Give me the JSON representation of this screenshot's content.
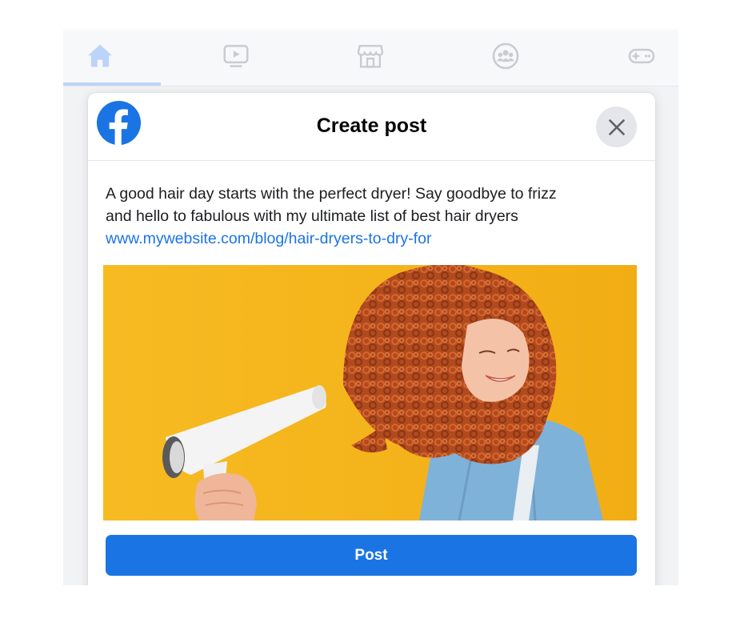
{
  "nav": {
    "tabs": [
      {
        "name": "home",
        "icon": "home-icon",
        "active": true
      },
      {
        "name": "watch",
        "icon": "video-icon",
        "active": false
      },
      {
        "name": "marketplace",
        "icon": "store-icon",
        "active": false
      },
      {
        "name": "groups",
        "icon": "groups-icon",
        "active": false
      },
      {
        "name": "gaming",
        "icon": "gamepad-icon",
        "active": false
      }
    ],
    "active_color": "#bcd4f7",
    "inactive_color": "#c8cbd0"
  },
  "modal": {
    "logo": "facebook-logo",
    "title": "Create post",
    "close_icon": "close-icon",
    "post_text_line1": "A good hair day starts with the perfect dryer! Say goodbye to frizz",
    "post_text_line2": "and hello to fabulous with my ultimate list of best hair dryers",
    "post_link": "www.mywebsite.com/blog/hair-dryers-to-dry-for",
    "image": "woman-with-curly-red-hair-and-hair-dryer",
    "post_button_label": "Post"
  },
  "colors": {
    "brand_blue": "#1b74e4",
    "image_background": "#f5b51c"
  }
}
